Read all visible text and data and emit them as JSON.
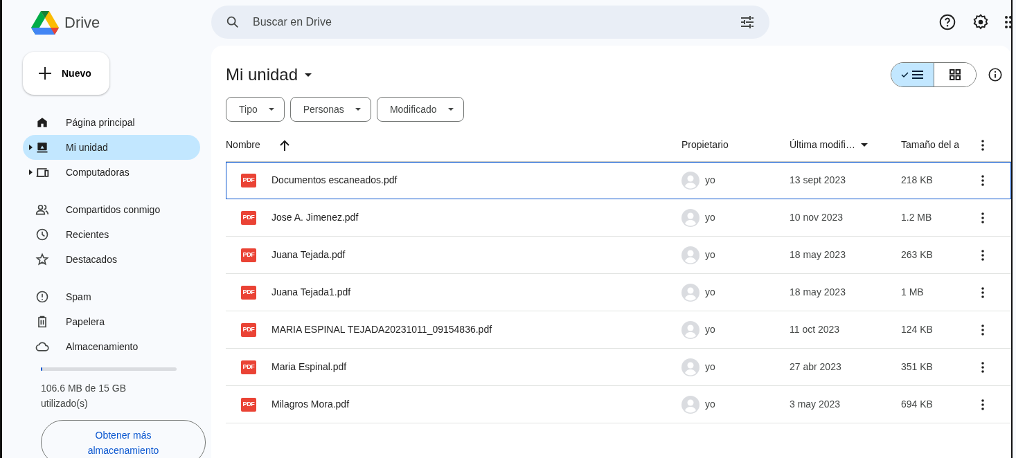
{
  "header": {
    "logo_text": "Drive",
    "search": {
      "placeholder": "Buscar en Drive"
    }
  },
  "sidebar": {
    "new_button": "Nuevo",
    "items": [
      {
        "label": "Página principal",
        "expandable": false,
        "selected": false
      },
      {
        "label": "Mi unidad",
        "expandable": true,
        "selected": true
      },
      {
        "label": "Computadoras",
        "expandable": true,
        "selected": false
      },
      {
        "label": "Compartidos conmigo",
        "expandable": false,
        "selected": false
      },
      {
        "label": "Recientes",
        "expandable": false,
        "selected": false
      },
      {
        "label": "Destacados",
        "expandable": false,
        "selected": false
      },
      {
        "label": "Spam",
        "expandable": false,
        "selected": false
      },
      {
        "label": "Papelera",
        "expandable": false,
        "selected": false
      },
      {
        "label": "Almacenamiento",
        "expandable": false,
        "selected": false
      }
    ],
    "storage": {
      "level": 0.01,
      "text": "106.6 MB de 15 GB utilizado(s)",
      "button": "Obtener más almacenamiento"
    }
  },
  "main": {
    "title": "Mi unidad",
    "view_toggle": [
      {
        "kind": "list",
        "selected": true
      },
      {
        "kind": "grid",
        "selected": false
      }
    ],
    "filters": [
      "Tipo",
      "Personas",
      "Modificado"
    ],
    "table": {
      "columns": [
        "Nombre",
        "Propietario",
        "Última modifi…",
        "Tamaño del a"
      ],
      "rows": [
        {
          "name": "Documentos escaneados.pdf",
          "icon_text": "PDF",
          "owner": "yo",
          "modified": "13 sept 2023",
          "size": "218 KB",
          "focused": true
        },
        {
          "name": "Jose A. Jimenez.pdf",
          "icon_text": "PDF",
          "owner": "yo",
          "modified": "10 nov 2023",
          "size": "1.2 MB",
          "focused": false
        },
        {
          "name": "Juana Tejada.pdf",
          "icon_text": "PDF",
          "owner": "yo",
          "modified": "18 may 2023",
          "size": "263 KB",
          "focused": false
        },
        {
          "name": "Juana Tejada1.pdf",
          "icon_text": "PDF",
          "owner": "yo",
          "modified": "18 may 2023",
          "size": "1 MB",
          "focused": false
        },
        {
          "name": "MARIA ESPINAL TEJADA20231011_09154836.pdf",
          "icon_text": "PDF",
          "owner": "yo",
          "modified": "11 oct 2023",
          "size": "124 KB",
          "focused": false
        },
        {
          "name": "Maria Espinal.pdf",
          "icon_text": "PDF",
          "owner": "yo",
          "modified": "27 abr 2023",
          "size": "351 KB",
          "focused": false
        },
        {
          "name": "Milagros Mora.pdf",
          "icon_text": "PDF",
          "owner": "yo",
          "modified": "3 may 2023",
          "size": "694 KB",
          "focused": false
        }
      ]
    }
  }
}
